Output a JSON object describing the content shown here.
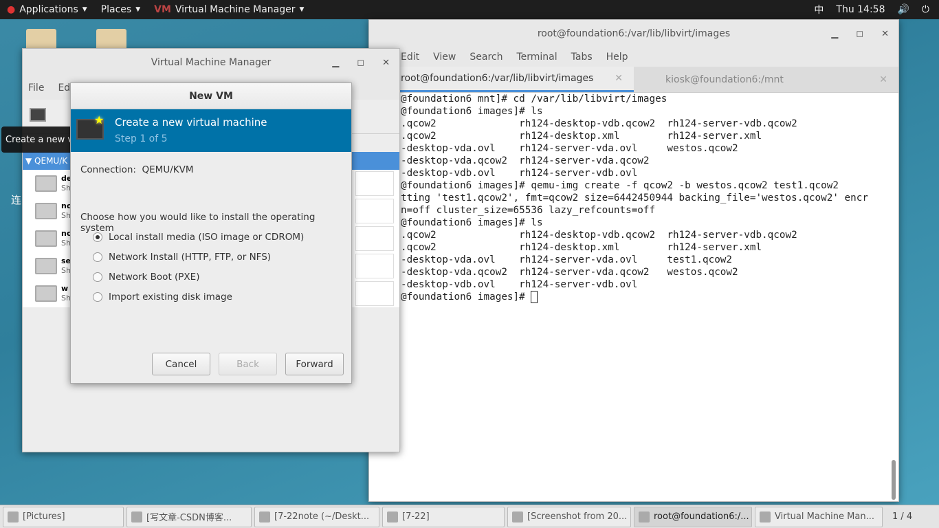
{
  "topbar": {
    "applications": "Applications",
    "places": "Places",
    "app": "Virtual Machine Manager",
    "input": "中",
    "clock": "Thu 14:58"
  },
  "desktop": {
    "side_char": "连"
  },
  "terminal": {
    "title": "root@foundation6:/var/lib/libvirt/images",
    "menu": [
      "Edit",
      "View",
      "Search",
      "Terminal",
      "Tabs",
      "Help"
    ],
    "tabs": [
      {
        "label": "root@foundation6:/var/lib/libvirt/images",
        "active": true
      },
      {
        "label": "kiosk@foundation6:/mnt",
        "active": false
      }
    ],
    "lines": [
      "@foundation6 mnt]# cd /var/lib/libvirt/images",
      "@foundation6 images]# ls",
      ".qcow2              rh124-desktop-vdb.qcow2  rh124-server-vdb.qcow2",
      ".qcow2              rh124-desktop.xml        rh124-server.xml",
      "-desktop-vda.ovl    rh124-server-vda.ovl     westos.qcow2",
      "-desktop-vda.qcow2  rh124-server-vda.qcow2",
      "-desktop-vdb.ovl    rh124-server-vdb.ovl",
      "@foundation6 images]# qemu-img create -f qcow2 -b westos.qcow2 test1.qcow2",
      "tting 'test1.qcow2', fmt=qcow2 size=6442450944 backing_file='westos.qcow2' encr",
      "n=off cluster_size=65536 lazy_refcounts=off",
      "@foundation6 images]# ls",
      ".qcow2              rh124-desktop-vdb.qcow2  rh124-server-vdb.qcow2",
      ".qcow2              rh124-desktop.xml        rh124-server.xml",
      "-desktop-vda.ovl    rh124-server-vda.ovl     test1.qcow2",
      "-desktop-vda.qcow2  rh124-server-vda.qcow2   westos.qcow2",
      "-desktop-vdb.ovl    rh124-server-vdb.ovl"
    ],
    "prompt": "@foundation6 images]# "
  },
  "vmm": {
    "title": "Virtual Machine Manager",
    "menu": [
      "File",
      "Edit"
    ],
    "connection": "QEMU/K",
    "vms": [
      {
        "name": "de",
        "state": "Sh"
      },
      {
        "name": "nc",
        "state": "Sh"
      },
      {
        "name": "nc",
        "state": "Sh"
      },
      {
        "name": "se",
        "state": "Sh"
      },
      {
        "name": "w",
        "state": "Sh"
      }
    ]
  },
  "tooltip": "Create a new virtual machine",
  "dialog": {
    "title": "New VM",
    "heading": "Create a new virtual machine",
    "step": "Step 1 of 5",
    "connection_label": "Connection:",
    "connection_value": "QEMU/KVM",
    "prompt": "Choose how you would like to install the operating system",
    "options": [
      {
        "label": "Local install media (ISO image or CDROM)",
        "selected": true
      },
      {
        "label": "Network Install (HTTP, FTP, or NFS)",
        "selected": false
      },
      {
        "label": "Network Boot (PXE)",
        "selected": false
      },
      {
        "label": "Import existing disk image",
        "selected": false
      }
    ],
    "cancel": "Cancel",
    "back": "Back",
    "forward": "Forward"
  },
  "taskbar": {
    "items": [
      "[Pictures]",
      "[写文章-CSDN博客...",
      "[7-22note (~/Deskt...",
      "[7-22]",
      "[Screenshot from 20...",
      "root@foundation6:/...",
      "Virtual Machine Man..."
    ],
    "pager": "1 / 4"
  }
}
